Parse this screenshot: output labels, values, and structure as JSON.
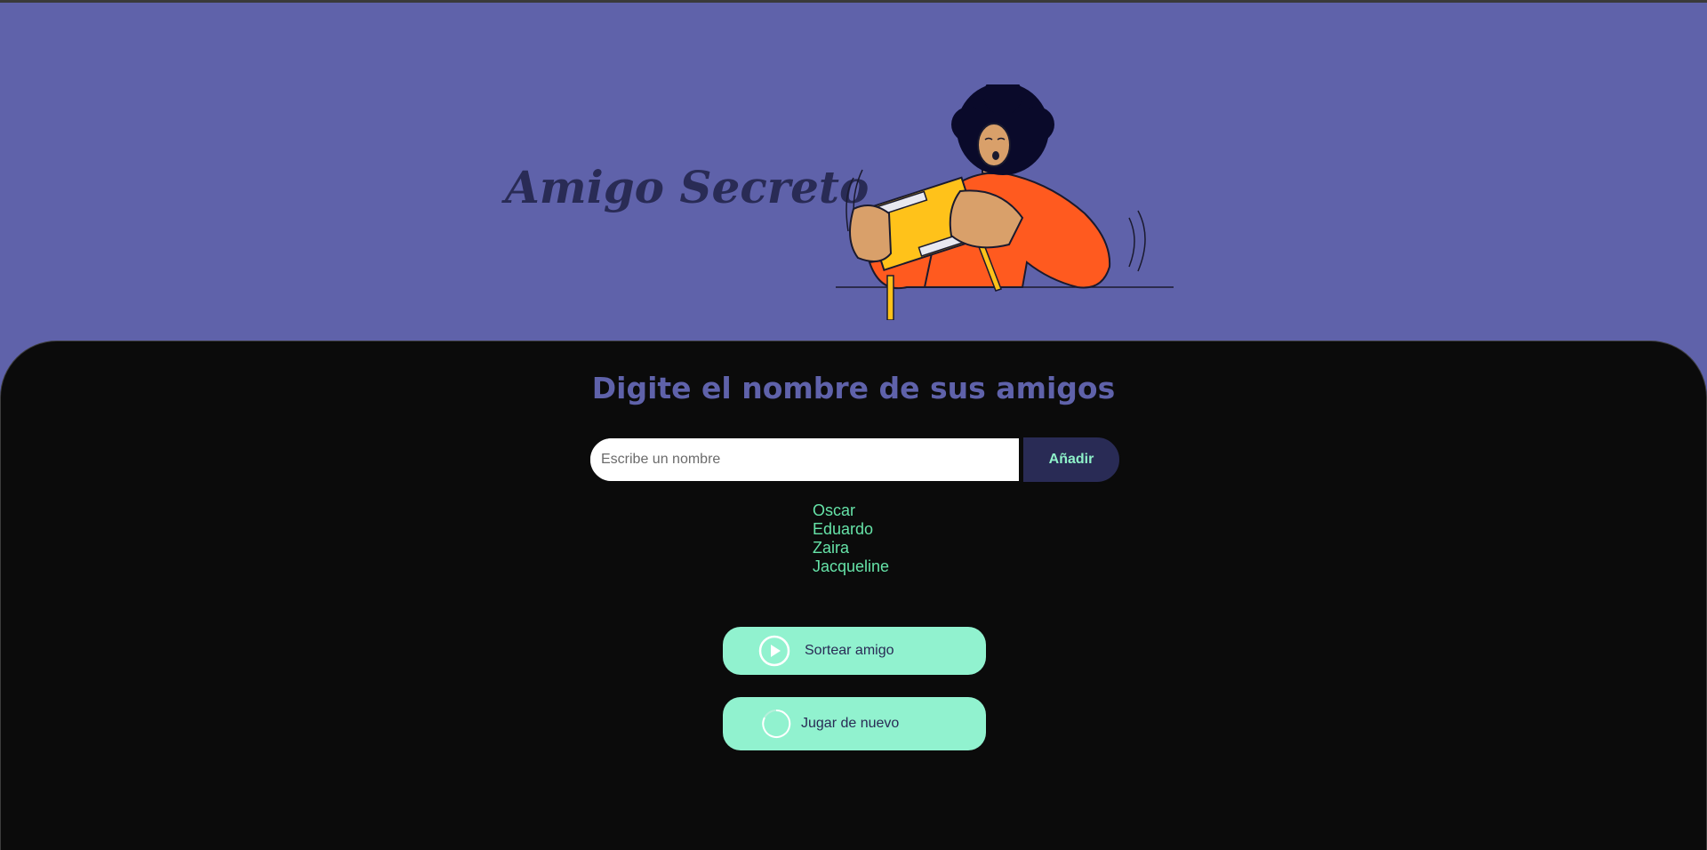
{
  "header": {
    "title": "Amigo Secreto"
  },
  "main": {
    "subtitle": "Digite el nombre de sus amigos",
    "input": {
      "placeholder": "Escribe un nombre",
      "value": ""
    },
    "add_button_label": "Añadir",
    "friends": [
      "Oscar",
      "Eduardo",
      "Zaira",
      "Jacqueline"
    ],
    "draw_button": {
      "label": "Sortear amigo",
      "icon": "play-icon"
    },
    "reset_button": {
      "label": "Jugar de nuevo",
      "icon": "refresh-icon"
    }
  },
  "colors": {
    "header_bg": "#5f62aa",
    "main_bg": "#0b0b0b",
    "title": "#292b55",
    "subtitle": "#5f62aa",
    "friend_text": "#66e3a8",
    "button_bg": "#91f2cf",
    "add_button_bg": "#292b55"
  }
}
